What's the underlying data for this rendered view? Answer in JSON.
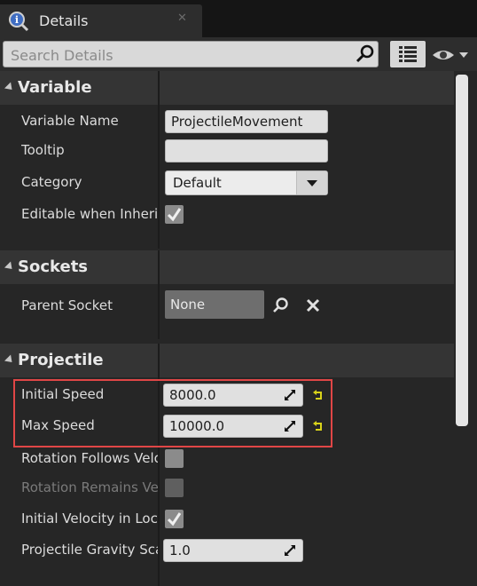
{
  "tab": {
    "title": "Details",
    "icon": "info-magnifier-icon",
    "close": "✕"
  },
  "toolbar": {
    "search_placeholder": "Search Details"
  },
  "sections": {
    "variable": {
      "title": "Variable",
      "rows": {
        "variable_name": {
          "label": "Variable Name",
          "value": "ProjectileMovement"
        },
        "tooltip": {
          "label": "Tooltip",
          "value": ""
        },
        "category": {
          "label": "Category",
          "value": "Default"
        },
        "editable": {
          "label": "Editable when Inherited",
          "checked": true
        }
      }
    },
    "sockets": {
      "title": "Sockets",
      "rows": {
        "parent_socket": {
          "label": "Parent Socket",
          "value": "None"
        }
      }
    },
    "projectile": {
      "title": "Projectile",
      "rows": {
        "initial_speed": {
          "label": "Initial Speed",
          "value": "8000.0"
        },
        "max_speed": {
          "label": "Max Speed",
          "value": "10000.0"
        },
        "rotation_follows": {
          "label": "Rotation Follows Velocity",
          "checked": false
        },
        "rotation_remains": {
          "label": "Rotation Remains Vertical",
          "checked": false,
          "disabled": true
        },
        "initial_velocity_local": {
          "label": "Initial Velocity in Local Space",
          "checked": true
        },
        "gravity_scale": {
          "label": "Projectile Gravity Scale",
          "value": "1.0"
        }
      }
    }
  },
  "colors": {
    "highlight": "#e04646",
    "reset_arrow": "#d8d21a",
    "background": "#262626"
  }
}
